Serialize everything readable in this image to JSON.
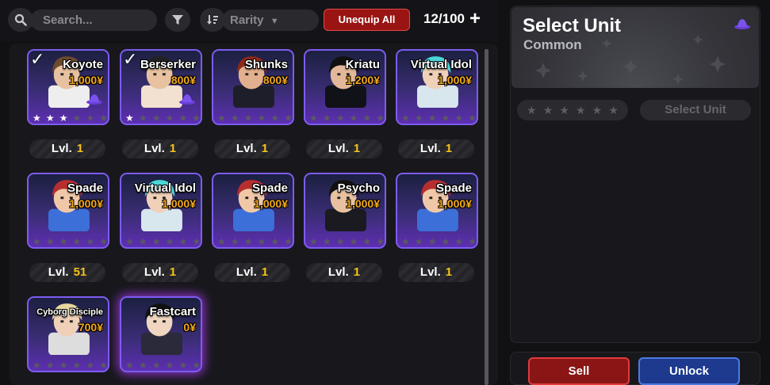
{
  "topbar": {
    "search_placeholder": "Search...",
    "rarity_label": "Rarity",
    "unequip_label": "Unequip All",
    "unit_count": "12/100",
    "add_label": "+"
  },
  "lvl_prefix": "Lvl.",
  "currency_symbol": "¥",
  "units": [
    {
      "name": "Koyote",
      "price": "1,000¥",
      "level": "1",
      "stars": 3,
      "equipped": true,
      "glow": false,
      "badge": "hat-icon"
    },
    {
      "name": "Berserker",
      "price": "800¥",
      "level": "1",
      "stars": 1,
      "equipped": true,
      "glow": false,
      "badge": "hat-icon"
    },
    {
      "name": "Shunks",
      "price": "800¥",
      "level": "1",
      "stars": 0,
      "equipped": false,
      "glow": false,
      "badge": ""
    },
    {
      "name": "Kriatu",
      "price": "1,200¥",
      "level": "1",
      "stars": 0,
      "equipped": false,
      "glow": false,
      "badge": ""
    },
    {
      "name": "Virtual Idol",
      "price": "1,000¥",
      "level": "1",
      "stars": 0,
      "equipped": false,
      "glow": false,
      "badge": ""
    },
    {
      "name": "Spade",
      "price": "1,000¥",
      "level": "51",
      "stars": 0,
      "equipped": false,
      "glow": false,
      "badge": ""
    },
    {
      "name": "Virtual Idol",
      "price": "1,000¥",
      "level": "1",
      "stars": 0,
      "equipped": false,
      "glow": false,
      "badge": ""
    },
    {
      "name": "Spade",
      "price": "1,000¥",
      "level": "1",
      "stars": 0,
      "equipped": false,
      "glow": false,
      "badge": ""
    },
    {
      "name": "Psycho",
      "price": "1,000¥",
      "level": "1",
      "stars": 0,
      "equipped": false,
      "glow": false,
      "badge": ""
    },
    {
      "name": "Spade",
      "price": "1,000¥",
      "level": "1",
      "stars": 0,
      "equipped": false,
      "glow": false,
      "badge": ""
    },
    {
      "name": "Cyborg Disciple",
      "price": "700¥",
      "level": "",
      "stars": 0,
      "equipped": false,
      "glow": false,
      "badge": ""
    },
    {
      "name": "Fastcart",
      "price": "0¥",
      "level": "",
      "stars": 0,
      "equipped": false,
      "glow": true,
      "badge": ""
    }
  ],
  "detail": {
    "title": "Select Unit",
    "rarity": "Common",
    "select_label": "Select Unit",
    "star_slots": 6
  },
  "actions": {
    "sell_label": "Sell",
    "unlock_label": "Unlock"
  },
  "colors": {
    "accent_red": "#9a1414",
    "accent_blue": "#1d3a8e",
    "price_gold": "#f4a81c",
    "level_gold": "#f6c21b",
    "card_border": "#7d5cf0"
  }
}
